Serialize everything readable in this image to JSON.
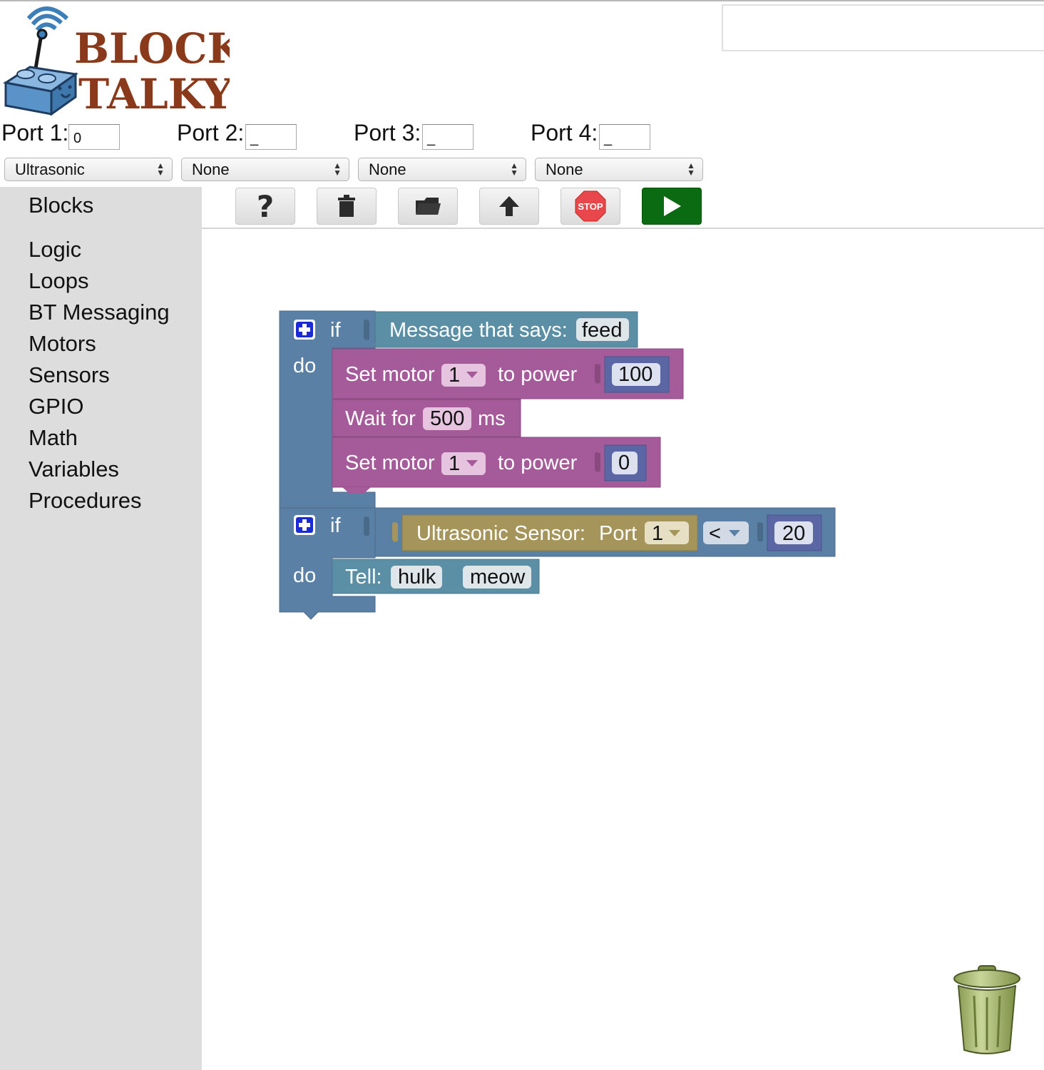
{
  "app": {
    "logo_line1": "BLOCKY",
    "logo_line2": "TALKY"
  },
  "ports": [
    {
      "label": "Port 1:",
      "value": "0",
      "sensor": "Ultrasonic"
    },
    {
      "label": "Port 2:",
      "value": "_",
      "sensor": "None"
    },
    {
      "label": "Port 3:",
      "value": "_",
      "sensor": "None"
    },
    {
      "label": "Port 4:",
      "value": "_",
      "sensor": "None"
    }
  ],
  "sidebar": {
    "title": "Blocks",
    "categories": [
      "Logic",
      "Loops",
      "BT Messaging",
      "Motors",
      "Sensors",
      "GPIO",
      "Math",
      "Variables",
      "Procedures"
    ]
  },
  "toolbar": {
    "help_icon": "question-icon",
    "delete_icon": "trash-icon",
    "open_icon": "folder-icon",
    "upload_icon": "upload-arrow-icon",
    "stop_label": "STOP",
    "run_icon": "play-icon",
    "run_color": "#0b6b12"
  },
  "blocks": {
    "if1": {
      "if_label": "if",
      "do_label": "do",
      "condition": {
        "text": "Message that says:",
        "value": "feed"
      },
      "set_motor_1": {
        "label": "Set motor",
        "motor": "1",
        "to_power": "to power",
        "power": "100"
      },
      "wait": {
        "label": "Wait for",
        "value": "500",
        "unit": "ms"
      },
      "set_motor_2": {
        "label": "Set motor",
        "motor": "1",
        "to_power": "to power",
        "power": "0"
      }
    },
    "if2": {
      "if_label": "if",
      "do_label": "do",
      "sensor": {
        "label": "Ultrasonic Sensor:",
        "port_label": "Port",
        "port": "1"
      },
      "operator": "<",
      "compare_value": "20",
      "tell": {
        "label": "Tell:",
        "target": "hulk",
        "message": "meow"
      }
    },
    "colors": {
      "logic": "#5b80a5",
      "motors": "#a55b99",
      "sensor": "#a5955b",
      "math": "#5b67a5",
      "messaging": "#5b8fa5"
    }
  }
}
